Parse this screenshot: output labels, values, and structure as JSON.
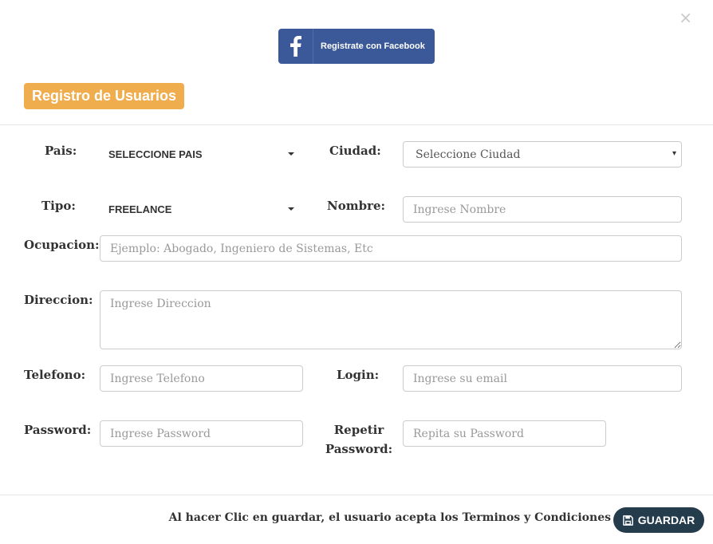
{
  "dialog": {
    "close_symbol": "×"
  },
  "facebook": {
    "label": "Registrate con Facebook",
    "icon": "facebook-f-icon",
    "color": "#3b5998"
  },
  "header": {
    "title": "Registro de Usuarios",
    "accent": "#f0ad4e"
  },
  "form": {
    "pais": {
      "label": "Pais:",
      "value": "SELECCIONE PAIS"
    },
    "ciudad": {
      "label": "Ciudad:",
      "value": "Seleccione Ciudad"
    },
    "tipo": {
      "label": "Tipo:",
      "value": "FREELANCE"
    },
    "nombre": {
      "label": "Nombre:",
      "value": "",
      "placeholder": "Ingrese Nombre"
    },
    "ocupacion": {
      "label": "Ocupacion:",
      "value": "",
      "placeholder": "Ejemplo: Abogado, Ingeniero de Sistemas, Etc"
    },
    "direccion": {
      "label": "Direccion:",
      "value": "",
      "placeholder": "Ingrese Direccion"
    },
    "telefono": {
      "label": "Telefono:",
      "value": "",
      "placeholder": "Ingrese Telefono"
    },
    "login": {
      "label": "Login:",
      "value": "",
      "placeholder": "Ingrese su email"
    },
    "password": {
      "label": "Password:",
      "value": "",
      "placeholder": "Ingrese Password"
    },
    "repeat": {
      "label_line1": "Repetir",
      "label_line2": "Password:",
      "value": "",
      "placeholder": "Repita su Password"
    }
  },
  "footer": {
    "terms_text": "Al hacer Clic en guardar, el usuario acepta los Terminos y Condiciones",
    "save_label": "GUARDAR",
    "save_icon": "floppy-disk-icon",
    "save_color": "#253c4d"
  }
}
